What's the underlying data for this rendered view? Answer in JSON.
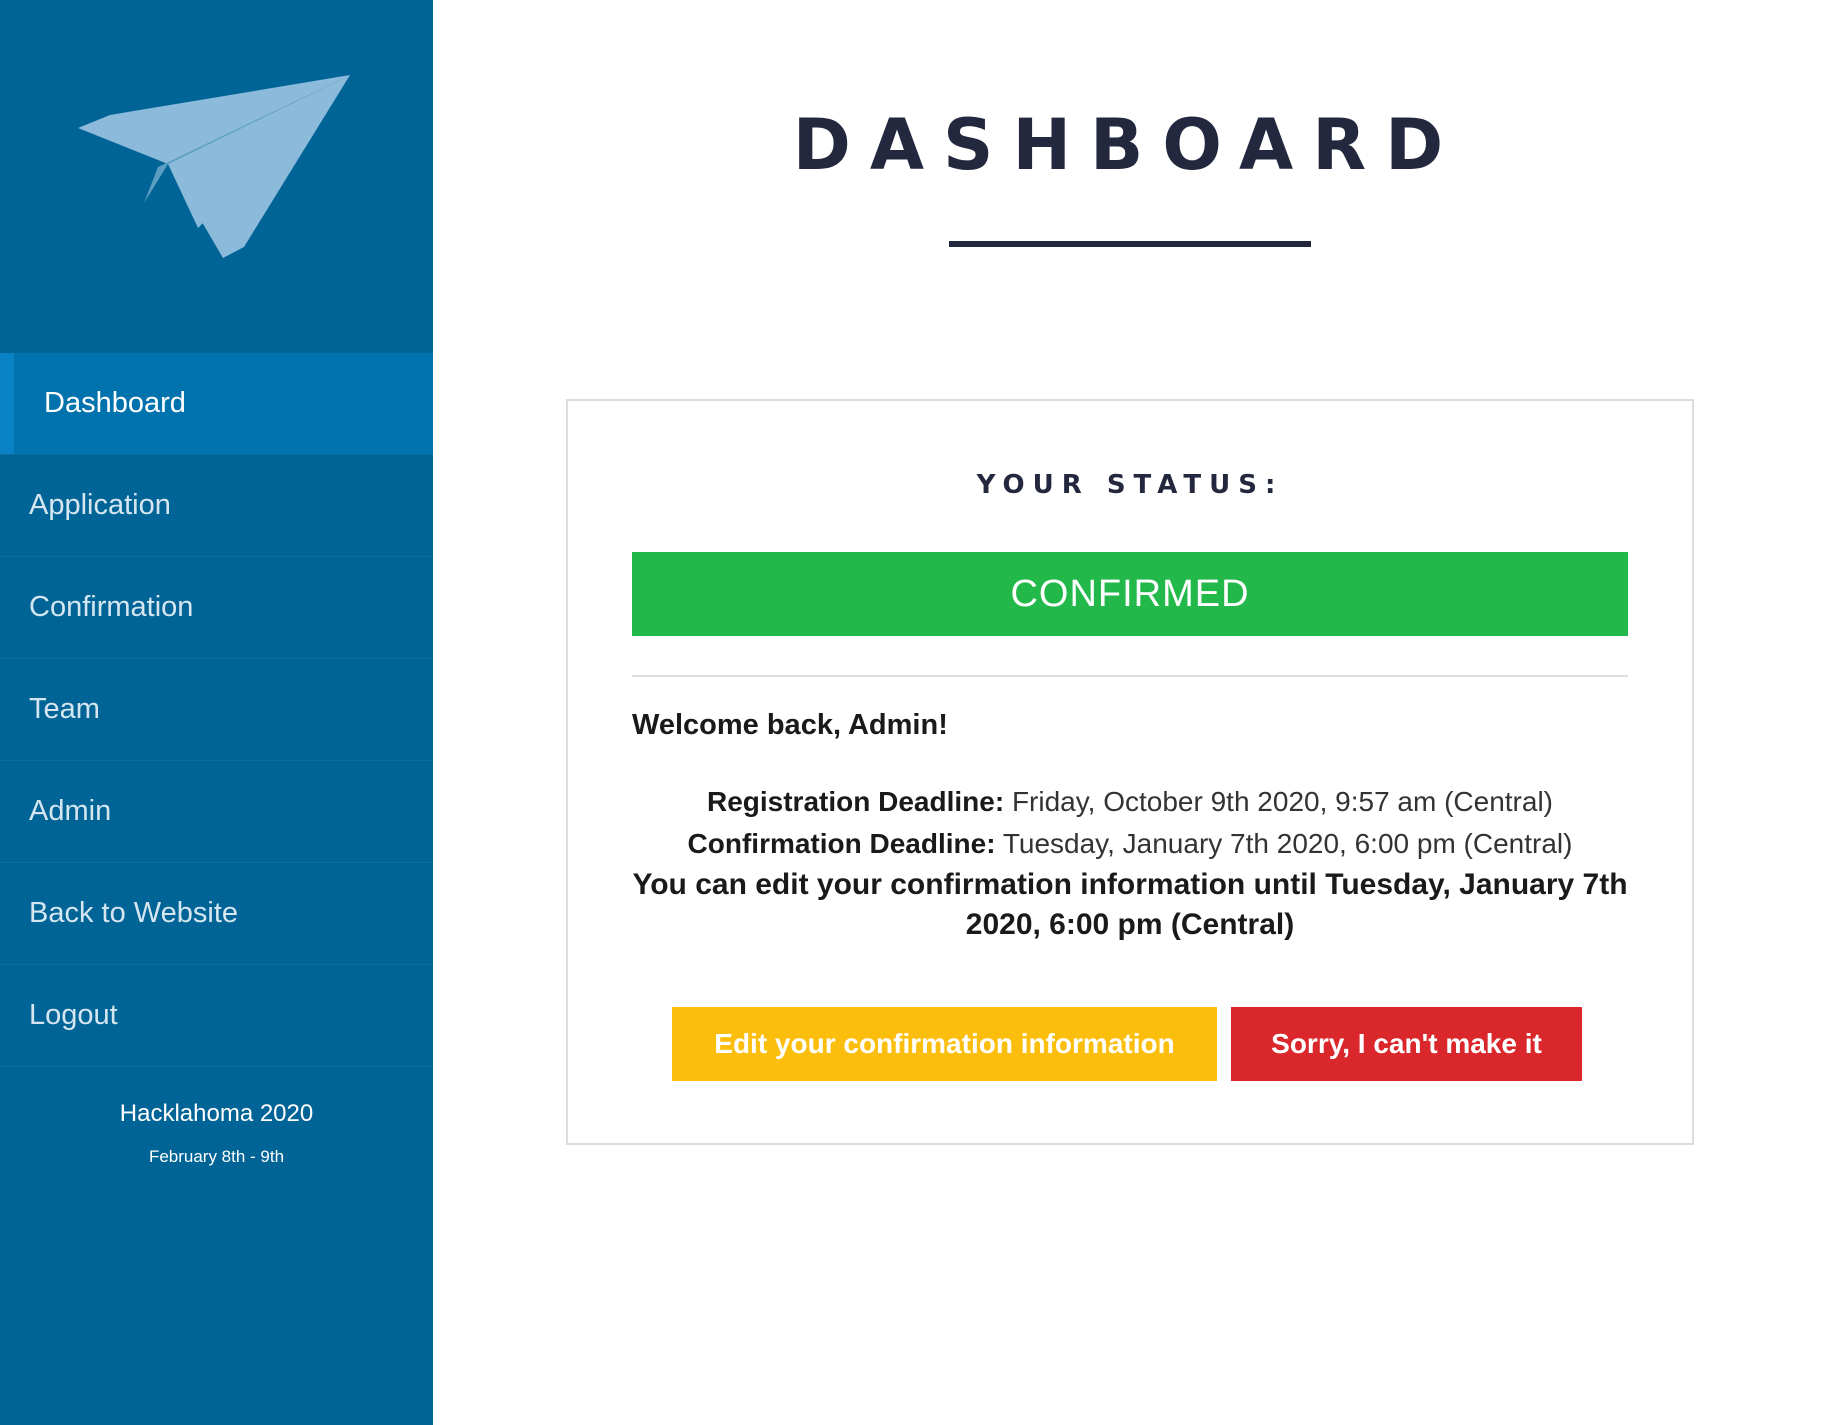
{
  "sidebar": {
    "logo_icon": "paper-plane-icon",
    "colors": {
      "background": "#006496",
      "active_item": "#0072ad",
      "active_indicator": "#0a83c6"
    },
    "items": [
      {
        "label": "Dashboard",
        "active": true
      },
      {
        "label": "Application",
        "active": false
      },
      {
        "label": "Confirmation",
        "active": false
      },
      {
        "label": "Team",
        "active": false
      },
      {
        "label": "Admin",
        "active": false
      },
      {
        "label": "Back to Website",
        "active": false
      },
      {
        "label": "Logout",
        "active": false
      }
    ],
    "footer": {
      "event_name": "Hacklahoma 2020",
      "event_dates": "February 8th - 9th"
    }
  },
  "main": {
    "title": "DASHBOARD",
    "status_card": {
      "label": "YOUR STATUS:",
      "status": "CONFIRMED",
      "status_color": "#22b94a",
      "welcome": "Welcome back, Admin!",
      "registration_deadline_label": "Registration Deadline:",
      "registration_deadline_value": "Friday, October 9th 2020, 9:57 am (Central)",
      "confirmation_deadline_label": "Confirmation Deadline:",
      "confirmation_deadline_value": "Tuesday, January 7th 2020, 6:00 pm (Central)",
      "edit_note": "You can edit your confirmation information until Tuesday, January 7th 2020, 6:00 pm (Central)",
      "edit_button_label": "Edit your confirmation information",
      "edit_button_color": "#fbbe0d",
      "decline_button_label": "Sorry, I can't make it",
      "decline_button_color": "#da272c"
    }
  }
}
